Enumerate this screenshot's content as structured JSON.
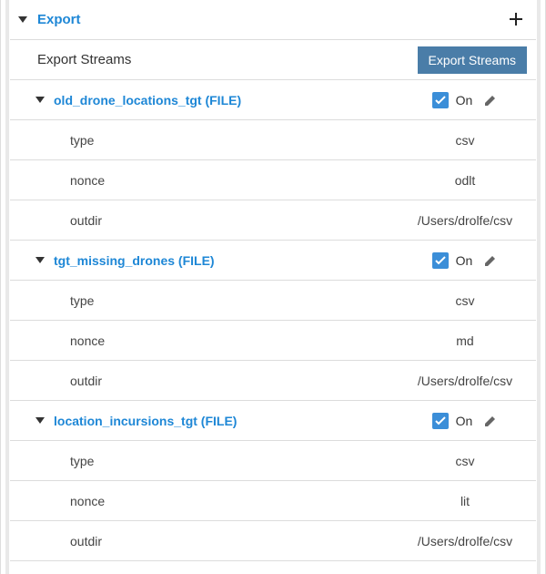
{
  "section": {
    "title": "Export",
    "add_icon": "plus-icon"
  },
  "header_row": {
    "label": "Export Streams",
    "button": "Export Streams"
  },
  "toggle": {
    "on_label": "On"
  },
  "streams": [
    {
      "name": "old_drone_locations_tgt (FILE)",
      "enabled": true,
      "props": [
        {
          "key": "type",
          "value": "csv"
        },
        {
          "key": "nonce",
          "value": "odlt"
        },
        {
          "key": "outdir",
          "value": "/Users/drolfe/csv"
        }
      ]
    },
    {
      "name": "tgt_missing_drones (FILE)",
      "enabled": true,
      "props": [
        {
          "key": "type",
          "value": "csv"
        },
        {
          "key": "nonce",
          "value": "md"
        },
        {
          "key": "outdir",
          "value": "/Users/drolfe/csv"
        }
      ]
    },
    {
      "name": "location_incursions_tgt (FILE)",
      "enabled": true,
      "props": [
        {
          "key": "type",
          "value": "csv"
        },
        {
          "key": "nonce",
          "value": "lit"
        },
        {
          "key": "outdir",
          "value": "/Users/drolfe/csv"
        }
      ]
    }
  ]
}
